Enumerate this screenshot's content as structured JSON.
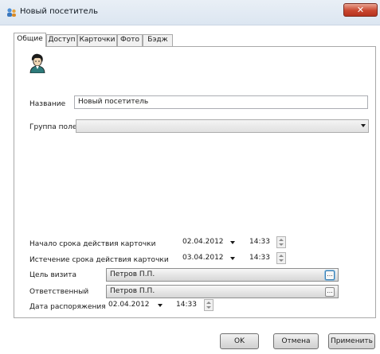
{
  "window": {
    "title": "Новый посетитель",
    "close_label": "✕"
  },
  "tabs": [
    {
      "label": "Общие",
      "active": true
    },
    {
      "label": "Доступ",
      "active": false
    },
    {
      "label": "Карточки",
      "active": false
    },
    {
      "label": "Фото",
      "active": false
    },
    {
      "label": "Бэдж",
      "active": false
    }
  ],
  "general": {
    "avatar_icon": "person-icon",
    "name_label": "Название",
    "name_value": "Новый посетитель",
    "group_label": "Группа полей",
    "group_value": ""
  },
  "validity": {
    "start_label": "Начало срока действия карточки",
    "start_date": "02.04.2012",
    "start_time": "14:33",
    "end_label": "Истечение срока действия карточки",
    "end_date": "03.04.2012",
    "end_time": "14:33"
  },
  "visit": {
    "purpose_label": "Цель визита",
    "purpose_value": "Петров П.П.",
    "responsible_label": "Ответственный",
    "responsible_value": "Петров П.П.",
    "order_date_label": "Дата распоряжения",
    "order_date": "02.04.2012",
    "order_time": "14:33",
    "ellipsis_label": "..."
  },
  "buttons": {
    "ok": "OK",
    "cancel": "Отмена",
    "apply": "Применить"
  },
  "colors": {
    "accent": "#3c7fb1",
    "close": "#c9462f"
  }
}
